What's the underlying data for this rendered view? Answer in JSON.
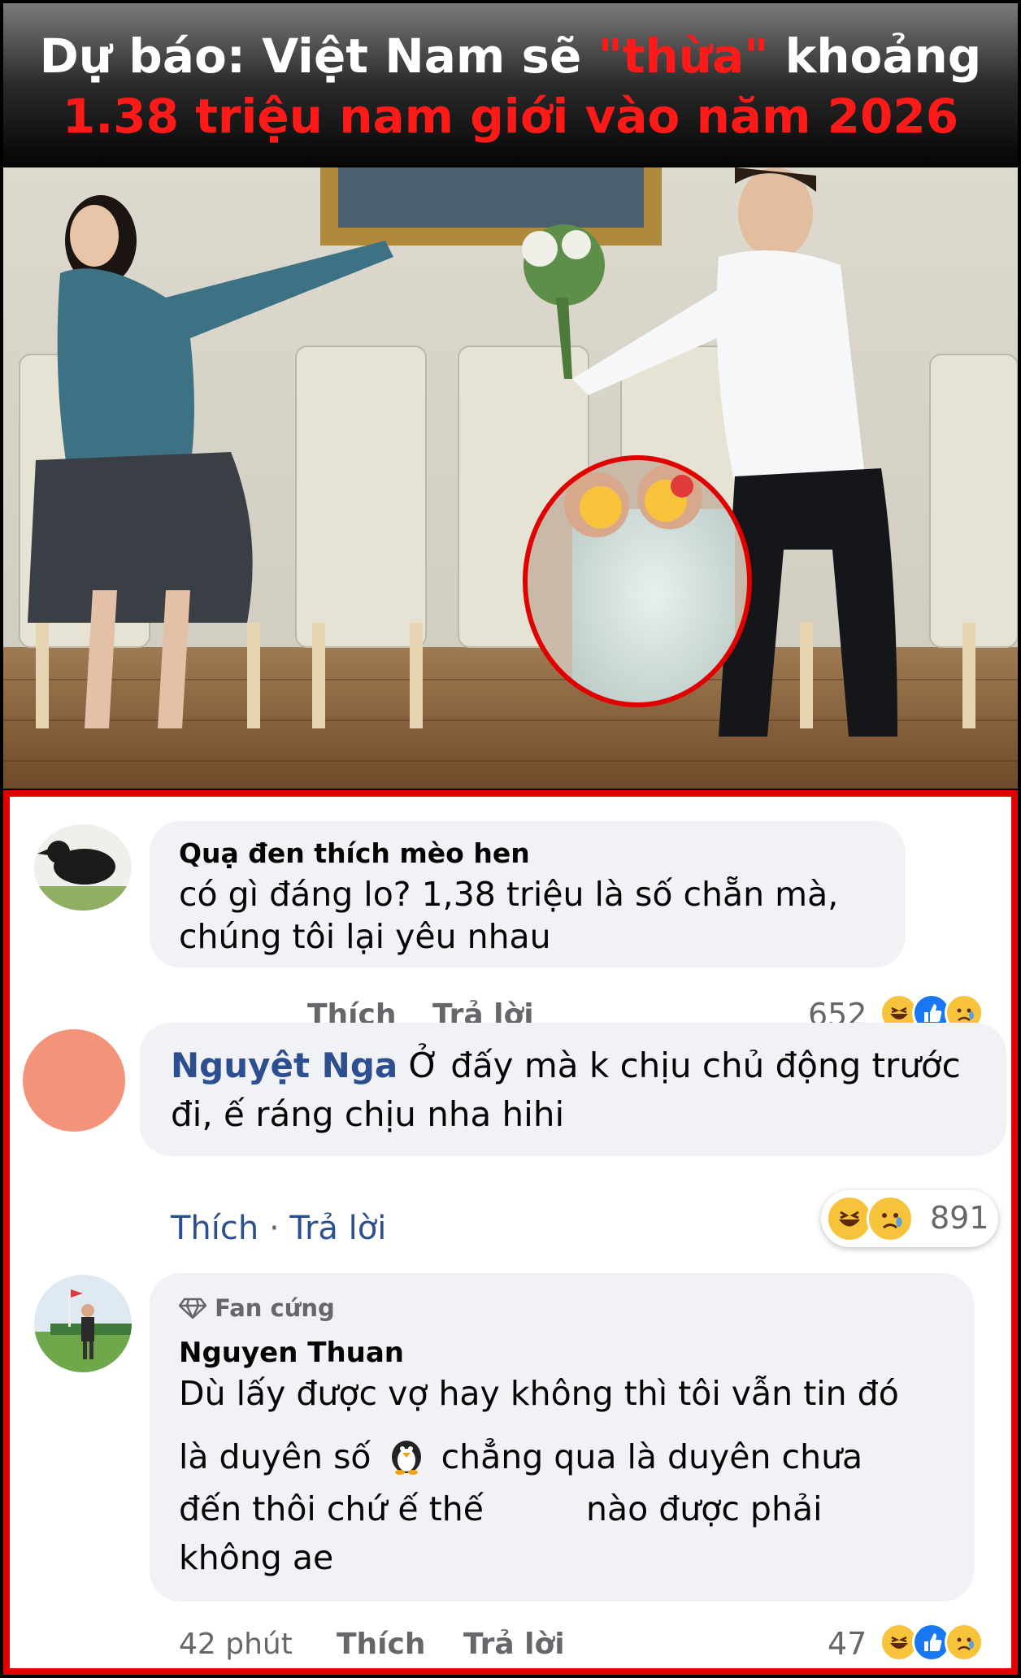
{
  "headline": {
    "line1_pre": "Dự báo: Việt Nam sẽ ",
    "line1_quote": "\"thừa\"",
    "line1_post": " khoảng",
    "line2": "1.38 triệu nam giới vào năm 2026"
  },
  "colors": {
    "accent_red": "#ff1a1a",
    "frame_red": "#e00000",
    "link_blue": "#2d4f8f",
    "bubble_gray": "#f0f2f5"
  },
  "comments": [
    {
      "author": "Quạ đen thích mèo hen",
      "text_line1": "có gì đáng lo? 1,38 triệu là số chẵn mà,",
      "text_line2": "chúng tôi lại yêu nhau",
      "like": "Thích",
      "reply": "Trả lời",
      "count": "652",
      "reactions": [
        "haha-icon",
        "like-icon",
        "sad-icon"
      ]
    },
    {
      "author": "Nguyệt Nga",
      "text_line1": " Ở đấy mà k chịu chủ động trước",
      "text_line2": "đi, ế ráng chịu nha hihi",
      "like": "Thích",
      "sep": " · ",
      "reply": "Trả lời",
      "count": "891",
      "reactions": [
        "haha-icon",
        "sad-icon"
      ]
    },
    {
      "badge": "Fan cứng",
      "author": "Nguyen Thuan",
      "text_line1": "Dù lấy được vợ hay không thì tôi vẫn tin đó",
      "text_line2a": "là duyên số",
      "text_line2b": "chẳng qua là duyên chưa",
      "text_line3a": "đến thôi chứ ế thế",
      "text_line3b": "nào được phải",
      "text_line4": "không ae",
      "time": "42 phút",
      "like": "Thích",
      "reply": "Trả lời",
      "count": "47",
      "reactions": [
        "haha-icon",
        "like-icon",
        "sad-icon"
      ]
    }
  ]
}
